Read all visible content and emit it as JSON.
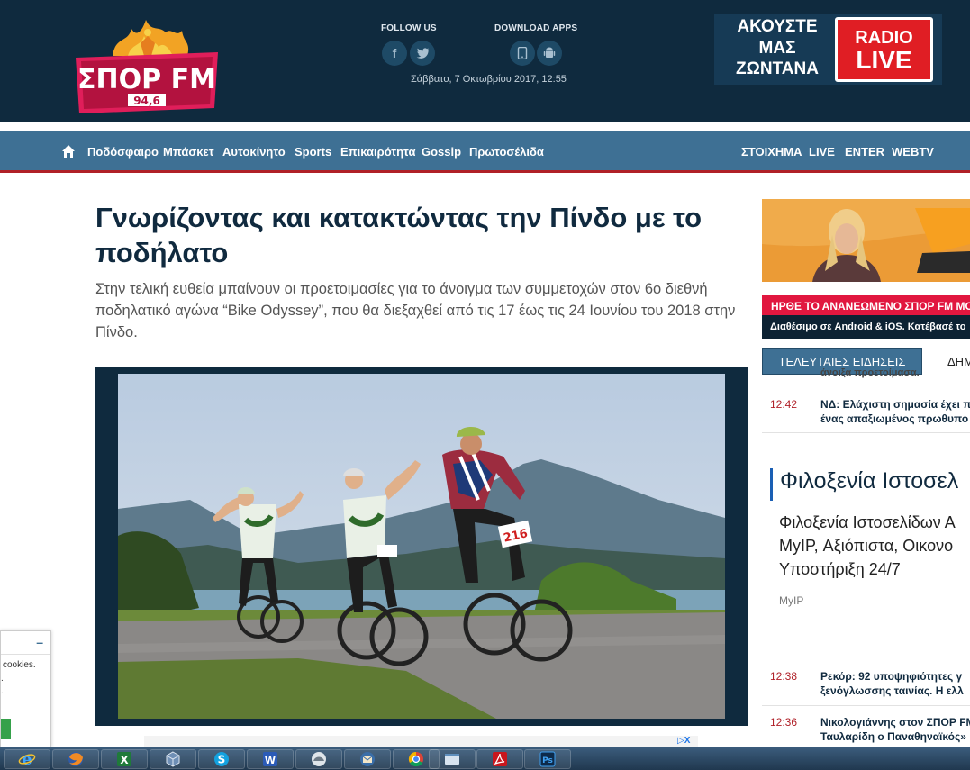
{
  "header": {
    "logo_main": "ΣΠΟΡ FM",
    "logo_freq": "94,6",
    "follow_label": "FOLLOW US",
    "download_label": "DOWNLOAD APPS",
    "datetime": "Σάββατο, 7 Οκτωβρίου 2017, 12:55",
    "live_text_1": "ΑΚΟΥΣΤΕ",
    "live_text_2": "ΜΑΣ",
    "live_text_3": "ΖΩΝΤΑΝΑ",
    "radio_label": "RADIO",
    "live_label": "LIVE",
    "social_icons": [
      "facebook-icon",
      "twitter-icon"
    ],
    "app_icons": [
      "apple-icon",
      "android-icon"
    ]
  },
  "nav": {
    "left": [
      "Ποδόσφαιρο",
      "Μπάσκετ",
      "Αυτοκίνητο",
      "Sports",
      "Επικαιρότητα",
      "Gossip",
      "Πρωτοσέλιδα"
    ],
    "right": [
      "ΣΤΟΙΧΗΜΑ",
      "LIVE",
      "ENTER",
      "WEBTV"
    ]
  },
  "article": {
    "title": "Γνωρίζοντας και κατακτώντας την Πίνδο με το ποδήλατο",
    "lead": "Στην τελική ευθεία μπαίνουν οι προετοιμασίες για το άνοιγμα των συμμετοχών στον 6ο διεθνή ποδηλατικό αγώνα “Bike Odyssey”, που θα διεξαχθεί από τις 17 έως τις 24 Ιουνίου του 2018 στην Πίνδο.",
    "bib_number": "216"
  },
  "sidebar": {
    "app_strip": "ΗΡΘΕ ΤΟ ΑΝΑΝΕΩΜΕΝΟ ΣΠΟΡ FM MO",
    "app_strip_sub": "Διαθέσιμο σε Android & iOS. Κατέβασέ το",
    "tab_active": "ΤΕΛΕΥΤΑΙΕΣ ΕΙΔΗΣΕΙΣ",
    "tab_next": "ΔΗΜ",
    "news_top_partial": "άνοιξα προετοίμασα.",
    "news": [
      {
        "time": "12:42",
        "line1": "ΝΔ: Ελάχιστη σημασία έχει π",
        "line2": "ένας απαξιωμένος πρωθυπο"
      },
      {
        "time": "12:38",
        "line1": "Ρεκόρ: 92 υποψηφιότητες γ",
        "line2": "ξενόγλωσσης ταινίας. Η ελλ"
      },
      {
        "time": "12:36",
        "line1": "Νικολογιάννης στον ΣΠΟΡ FM",
        "line2": "Ταυλαρίδη ο Παναθηναϊκός»"
      }
    ],
    "ad": {
      "title": "Φιλοξενία Ιστοσελ",
      "body_1": "Φιλοξενία Ιστοσελίδων Α",
      "body_2": "MyIP, Αξιόπιστα, Οικονο",
      "body_3": "Υποστήριξη 24/7",
      "source": "MyIP"
    }
  },
  "cookie": {
    "minimize": "–",
    "text": "cookies.",
    "dot1": ".",
    "dot2": "."
  },
  "bottom_ad": {
    "close": "▷X"
  },
  "taskbar": {
    "apps": [
      "internet-explorer-icon",
      "firefox-icon",
      "excel-icon",
      "virtualbox-icon",
      "skype-icon",
      "word-icon",
      "app-icon",
      "thunderbird-icon",
      "chrome-icon",
      "explorer-icon",
      "acrobat-icon",
      "photoshop-icon"
    ],
    "excel_letter": "X",
    "word_letter": "W",
    "ps_letter": "Ps"
  },
  "colors": {
    "header_bg": "#0f2a3e",
    "nav_bg": "#3e7094",
    "accent_red": "#e01e24",
    "title_color": "#102a3f"
  }
}
